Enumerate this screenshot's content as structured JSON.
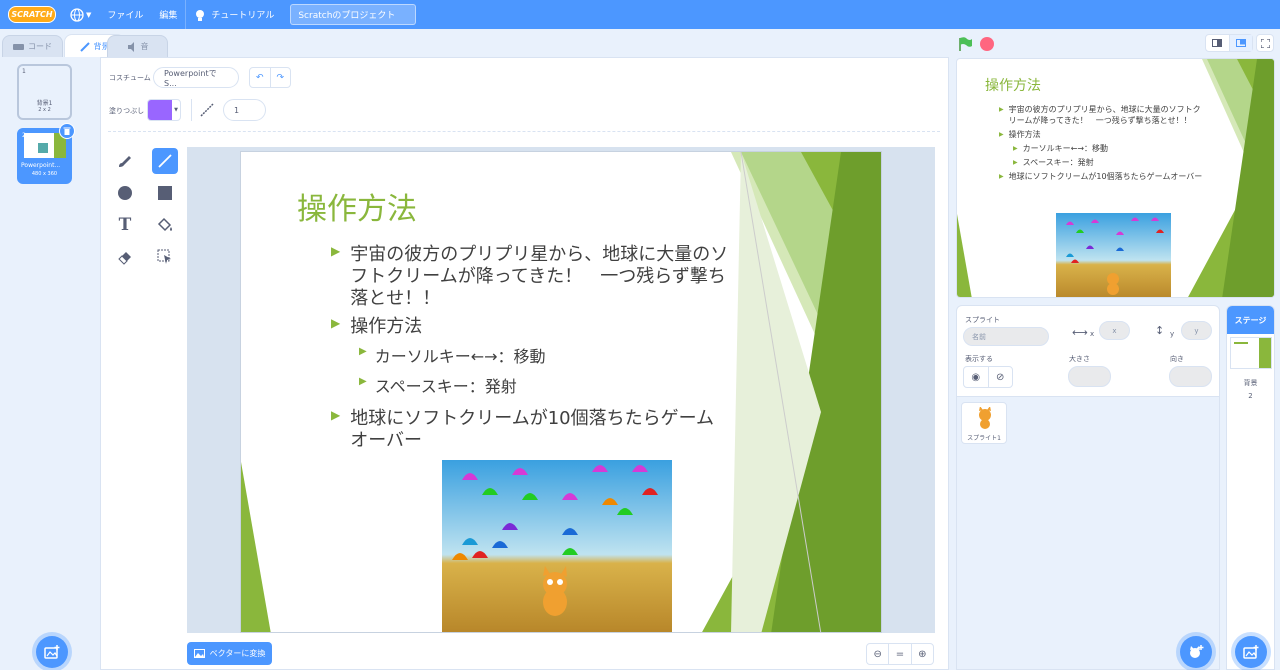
{
  "menu": {
    "logo": "SCRATCH",
    "file": "ファイル",
    "edit": "編集",
    "tutorial": "チュートリアル",
    "project_title": "Scratchのプロジェクト"
  },
  "tabs": {
    "code": "コード",
    "backdrops": "背景",
    "sounds": "音"
  },
  "costumes": [
    {
      "index": "1",
      "name": "背景1",
      "size": "2 x 2"
    },
    {
      "index": "2",
      "name": "Powerpoint...",
      "size": "480 x 360"
    }
  ],
  "editor": {
    "costume_label": "コスチューム",
    "costume_name": "PowerpointでS...",
    "fill_label": "塗りつぶし",
    "fill_color": "#9966ff",
    "outline_width": "1",
    "convert_button": "ベクターに変換",
    "zoom_reset": "="
  },
  "slide": {
    "title": "操作方法",
    "bullets": [
      {
        "level": 1,
        "text": "宇宙の彼方のプリプリ星から、地球に大量のソフトクリームが降ってきた！　一つ残らず撃ち落とせ！！"
      },
      {
        "level": 1,
        "text": "操作方法"
      },
      {
        "level": 2,
        "text": "カーソルキー←→：移動"
      },
      {
        "level": 2,
        "text": "スペースキー：発射"
      },
      {
        "level": 1,
        "text": "地球にソフトクリームが10個落ちたらゲームオーバー"
      }
    ],
    "title_color": "#8ab73c",
    "accent_color": "#8ab73c"
  },
  "sprite_info": {
    "sprite_label": "スプライト",
    "name_placeholder": "名前",
    "x_placeholder": "x",
    "y_placeholder": "y",
    "x_label": "x",
    "y_label": "y",
    "show_label": "表示する",
    "size_label": "大きさ",
    "direction_label": "向き"
  },
  "sprites": [
    {
      "name": "スプライト1"
    }
  ],
  "stage_panel": {
    "title": "ステージ",
    "backdrops_label": "背景",
    "backdrops_count": "2"
  },
  "colors": {
    "accent": "#4c97ff",
    "menubar": "#4c97ff",
    "stop": "#ff6680",
    "flag": "#4cbf56"
  }
}
